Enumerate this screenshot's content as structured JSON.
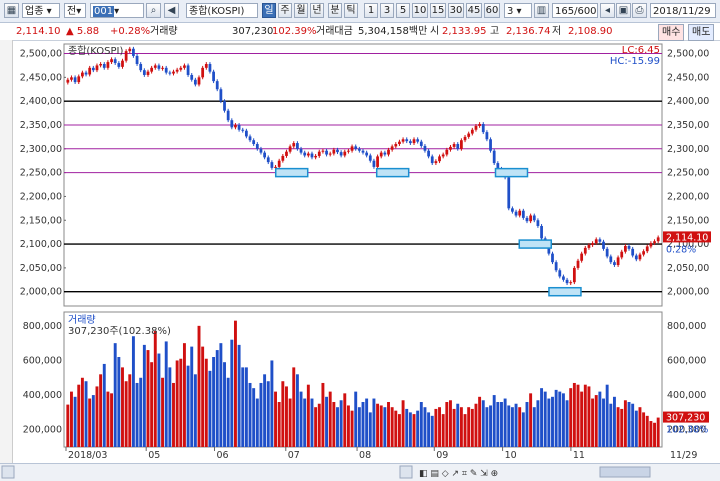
{
  "toolbar": {
    "type_label": "업종",
    "market_label": "전",
    "code": "001",
    "index_name": "종합(KOSPI)",
    "period_selected": "일",
    "periods": [
      "주",
      "월",
      "년",
      "분",
      "틱"
    ],
    "multipliers": [
      "1",
      "3",
      "5",
      "10",
      "15",
      "30",
      "45",
      "60"
    ],
    "multiplier_value": "3",
    "count": "165/600",
    "date": "2018/11/29"
  },
  "info": {
    "price": "2,114.10",
    "change": "▲ 5.88",
    "change_pct": "+0.28%",
    "volume_label": "거래량",
    "volume": "307,230",
    "volume_ratio": "102.39%",
    "amount_label": "거래대금",
    "amount": "5,304,158백만",
    "open_label": "시",
    "open": "2,133.95",
    "high_label": "고",
    "high": "2,136.74",
    "low_label": "저",
    "low": "2,108.90",
    "buy_label": "매수",
    "sell_label": "매도"
  },
  "colors": {
    "up": "#d01010",
    "down": "#1f4fc8",
    "purple_line": "#a020a0",
    "box": "#1a8fd0"
  },
  "chart_data": [
    {
      "type": "candlestick",
      "title": "종합(KOSPI)",
      "ylim": [
        1970,
        2520
      ],
      "y_ticks": [
        "2,500,00",
        "2,450,00",
        "2,400,00",
        "2,350,00",
        "2,300,00",
        "2,250,00",
        "2,200,00",
        "2,150,00",
        "2,100,00",
        "2,050,00",
        "2,000,00"
      ],
      "y_tick_values": [
        2500,
        2450,
        2400,
        2350,
        2300,
        2250,
        2200,
        2150,
        2100,
        2050,
        2000
      ],
      "x_labels": [
        "2018/03",
        "05",
        "06",
        "07",
        "08",
        "09",
        "10",
        "11"
      ],
      "high_low": {
        "lc_label": "LC:6.45",
        "hc_label": "HC:-15.99"
      },
      "last_price_label": "2,114.10",
      "last_pct_label": "0.28%",
      "purple_lines": [
        2500,
        2350,
        2300,
        2250
      ],
      "black_lines": [
        2400,
        2100,
        2000
      ],
      "closes": [
        2445,
        2450,
        2440,
        2452,
        2460,
        2456,
        2470,
        2465,
        2475,
        2478,
        2470,
        2482,
        2488,
        2480,
        2472,
        2485,
        2505,
        2510,
        2495,
        2478,
        2465,
        2455,
        2462,
        2470,
        2475,
        2468,
        2470,
        2460,
        2458,
        2462,
        2466,
        2470,
        2475,
        2455,
        2445,
        2435,
        2450,
        2470,
        2478,
        2462,
        2442,
        2425,
        2400,
        2380,
        2360,
        2345,
        2350,
        2340,
        2338,
        2326,
        2318,
        2310,
        2300,
        2292,
        2282,
        2272,
        2260,
        2262,
        2275,
        2285,
        2294,
        2305,
        2312,
        2300,
        2292,
        2286,
        2290,
        2282,
        2285,
        2294,
        2296,
        2288,
        2290,
        2298,
        2293,
        2286,
        2294,
        2296,
        2305,
        2300,
        2296,
        2292,
        2286,
        2275,
        2262,
        2284,
        2292,
        2288,
        2298,
        2305,
        2310,
        2315,
        2320,
        2316,
        2312,
        2320,
        2315,
        2306,
        2296,
        2284,
        2270,
        2274,
        2284,
        2288,
        2298,
        2304,
        2310,
        2300,
        2318,
        2325,
        2332,
        2340,
        2348,
        2352,
        2335,
        2320,
        2296,
        2270,
        2258,
        2250,
        2240,
        2175,
        2168,
        2160,
        2170,
        2155,
        2148,
        2160,
        2150,
        2138,
        2112,
        2100,
        2080,
        2062,
        2045,
        2032,
        2025,
        2018,
        2020,
        2050,
        2065,
        2080,
        2092,
        2098,
        2102,
        2110,
        2105,
        2090,
        2074,
        2062,
        2056,
        2072,
        2084,
        2096,
        2090,
        2076,
        2068,
        2078,
        2085,
        2095,
        2102,
        2106,
        2114
      ],
      "volume": {
        "label": "거래량",
        "value_label": "307,230주(102.38%)",
        "ylim": [
          100000,
          880000
        ],
        "y_ticks": [
          "800,000",
          "600,000",
          "400,000",
          "200,000"
        ],
        "y_tick_values": [
          800000,
          600000,
          400000,
          200000
        ],
        "last_value_label": "307,230",
        "last_pct_label": "102.38%",
        "end_label": "11/29",
        "values": [
          345000,
          420000,
          390000,
          460000,
          500000,
          480000,
          380000,
          400000,
          450000,
          520000,
          580000,
          420000,
          410000,
          700000,
          620000,
          560000,
          480000,
          520000,
          740000,
          470000,
          500000,
          690000,
          660000,
          590000,
          770000,
          640000,
          500000,
          710000,
          560000,
          470000,
          600000,
          610000,
          700000,
          570000,
          680000,
          520000,
          800000,
          680000,
          610000,
          540000,
          620000,
          660000,
          700000,
          590000,
          500000,
          720000,
          830000,
          690000,
          560000,
          560000,
          470000,
          440000,
          380000,
          470000,
          520000,
          480000,
          600000,
          420000,
          360000,
          480000,
          450000,
          380000,
          560000,
          520000,
          420000,
          380000,
          460000,
          380000,
          330000,
          350000,
          470000,
          390000,
          420000,
          360000,
          330000,
          370000,
          410000,
          340000,
          310000,
          420000,
          330000,
          360000,
          380000,
          300000,
          380000,
          350000,
          340000,
          330000,
          360000,
          330000,
          310000,
          290000,
          370000,
          320000,
          300000,
          290000,
          310000,
          360000,
          330000,
          300000,
          280000,
          320000,
          330000,
          290000,
          360000,
          370000,
          320000,
          350000,
          330000,
          290000,
          330000,
          320000,
          350000,
          390000,
          370000,
          330000,
          340000,
          400000,
          360000,
          360000,
          380000,
          340000,
          330000,
          350000,
          330000,
          300000,
          360000,
          410000,
          330000,
          370000,
          440000,
          420000,
          380000,
          390000,
          430000,
          420000,
          410000,
          370000,
          440000,
          470000,
          460000,
          420000,
          460000,
          450000,
          380000,
          400000,
          420000,
          380000,
          460000,
          350000,
          390000,
          330000,
          320000,
          370000,
          360000,
          350000,
          310000,
          330000,
          300000,
          280000,
          250000,
          240000,
          270000,
          300000,
          307230
        ]
      }
    }
  ]
}
